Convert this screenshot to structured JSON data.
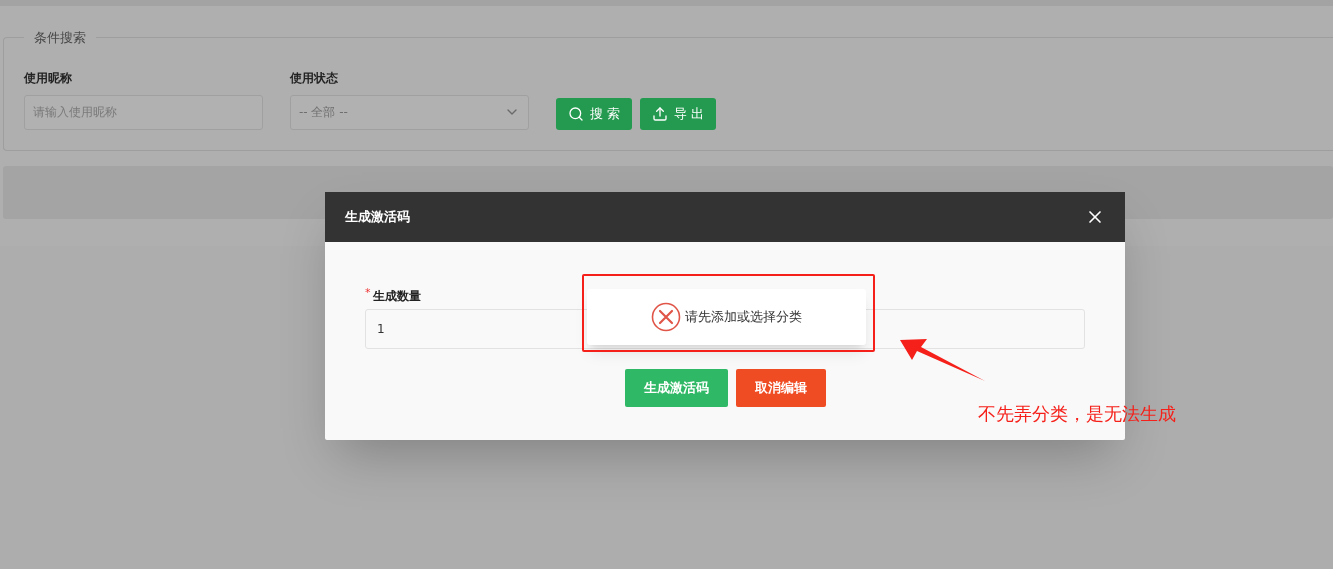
{
  "search_panel": {
    "legend": "条件搜索",
    "fields": [
      {
        "label": "使用昵称",
        "kind": "text",
        "placeholder": "请输入使用昵称"
      },
      {
        "label": "使用状态",
        "kind": "select",
        "value": "-- 全部 --"
      }
    ],
    "buttons": [
      {
        "label": "搜 索"
      },
      {
        "label": "导 出"
      }
    ]
  },
  "dialog": {
    "title": "生成激活码",
    "field": {
      "label": "生成数量",
      "required_mark": "*",
      "value": "1"
    },
    "buttons": [
      {
        "label": "生成激活码",
        "kind": "primary"
      },
      {
        "label": "取消编辑",
        "kind": "danger"
      }
    ]
  },
  "toast": {
    "message": "请先添加或选择分类",
    "kind": "error"
  },
  "annotation": {
    "text": "不先弄分类，是无法生成"
  }
}
